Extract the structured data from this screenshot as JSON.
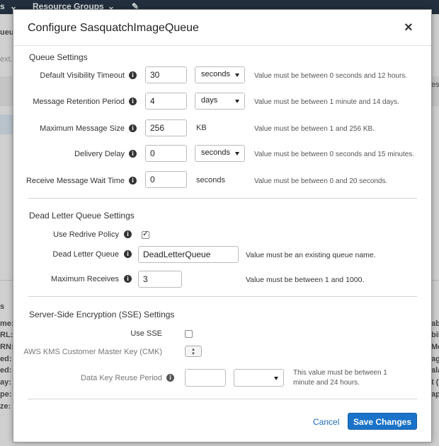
{
  "background": {
    "top_items": [
      "s",
      "Resource Groups"
    ],
    "left_fragments": [
      "ueue",
      "ext...",
      "s",
      "me:",
      "RL:",
      "RN:",
      "ed:",
      "ed:",
      "ay:",
      "pe:",
      "ze:"
    ],
    "right_fragments": [
      "ess",
      "abil",
      "bil",
      "Me",
      "age",
      "ala",
      "t (",
      "ap"
    ]
  },
  "modal": {
    "title": "Configure SasquatchImageQueue",
    "close_symbol": "×",
    "queue_settings": {
      "title": "Queue Settings",
      "visibility_timeout": {
        "label": "Default Visibility Timeout",
        "value": "30",
        "unit": "seconds",
        "hint": "Value must be between 0 seconds and 12 hours."
      },
      "retention_period": {
        "label": "Message Retention Period",
        "value": "4",
        "unit": "days",
        "hint": "Value must be between 1 minute and 14 days."
      },
      "max_message_size": {
        "label": "Maximum Message Size",
        "value": "256",
        "unit": "KB",
        "hint": "Value must be between 1 and 256 KB."
      },
      "delivery_delay": {
        "label": "Delivery Delay",
        "value": "0",
        "unit": "seconds",
        "hint": "Value must be between 0 seconds and 15 minutes."
      },
      "receive_wait_time": {
        "label": "Receive Message Wait Time",
        "value": "0",
        "unit": "seconds",
        "hint": "Value must be between 0 and 20 seconds."
      }
    },
    "dlq_settings": {
      "title": "Dead Letter Queue Settings",
      "use_redrive": {
        "label": "Use Redrive Policy",
        "checked": true
      },
      "dead_letter_queue": {
        "label": "Dead Letter Queue",
        "value": "DeadLetterQueue",
        "hint": "Value must be an existing queue name."
      },
      "max_receives": {
        "label": "Maximum Receives",
        "value": "3",
        "hint": "Value must be between 1 and 1000."
      }
    },
    "sse_settings": {
      "title": "Server-Side Encryption (SSE) Settings",
      "use_sse": {
        "label": "Use SSE",
        "checked": false
      },
      "kms_key": {
        "label": "AWS KMS Customer Master Key (CMK)"
      },
      "data_key_reuse": {
        "label": "Data Key Reuse Period",
        "value": "",
        "unit": "",
        "hint_line1": "This value must be between 1",
        "hint_line2": "minute and 24 hours."
      }
    },
    "footer": {
      "cancel_label": "Cancel",
      "save_label": "Save Changes"
    }
  }
}
